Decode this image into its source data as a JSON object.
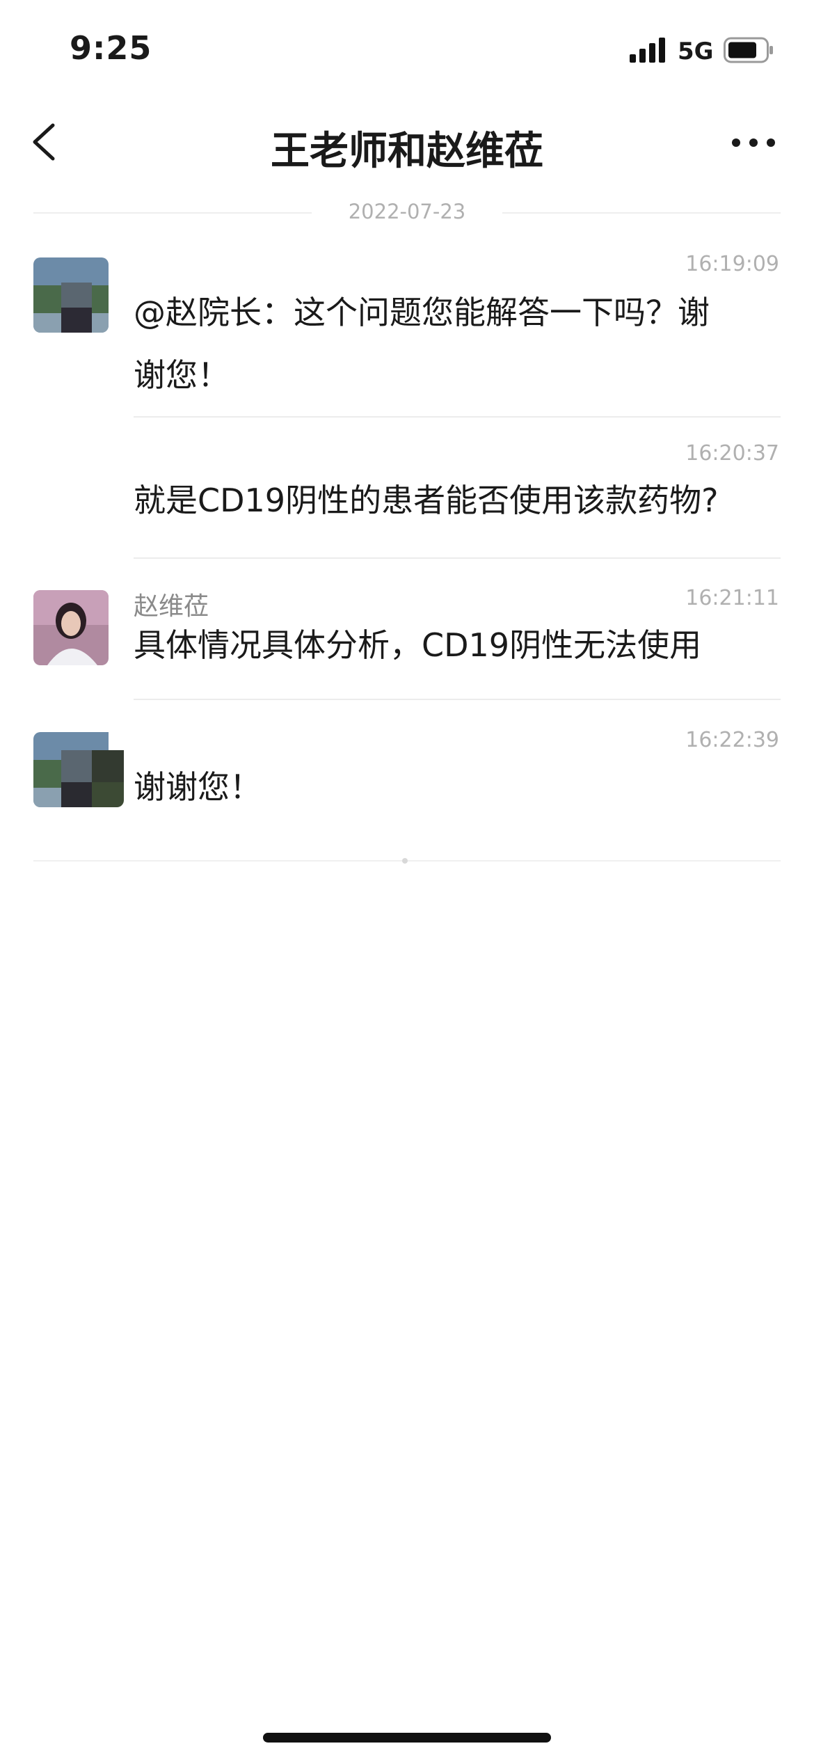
{
  "status_bar": {
    "time": "9:25",
    "network": "5G",
    "signal_icon": "signal-bars-icon",
    "battery_icon": "battery-icon"
  },
  "nav": {
    "title": "王老师和赵维莅",
    "back_icon": "chevron-left-icon",
    "more_icon": "more-dots-icon"
  },
  "date_divider": "2022-07-23",
  "messages": [
    {
      "sender": "",
      "time": "16:19:09",
      "text_line1": "@赵院长：这个问题您能解答一下吗？谢",
      "text_line2": "谢您！"
    },
    {
      "sender": "",
      "time": "16:20:37",
      "text_line1": "就是CD19阴性的患者能否使用该款药物?"
    },
    {
      "sender": "赵维莅",
      "time": "16:21:11",
      "text_line1": "具体情况具体分析，CD19阴性无法使用"
    },
    {
      "sender": "",
      "time": "16:22:39",
      "text_line1": "谢谢您！"
    }
  ],
  "colors": {
    "text_primary": "#1a1a1a",
    "text_secondary": "#8a8a8a",
    "timestamp": "#b0b0b0",
    "divider": "#ececec",
    "background": "#ffffff"
  }
}
